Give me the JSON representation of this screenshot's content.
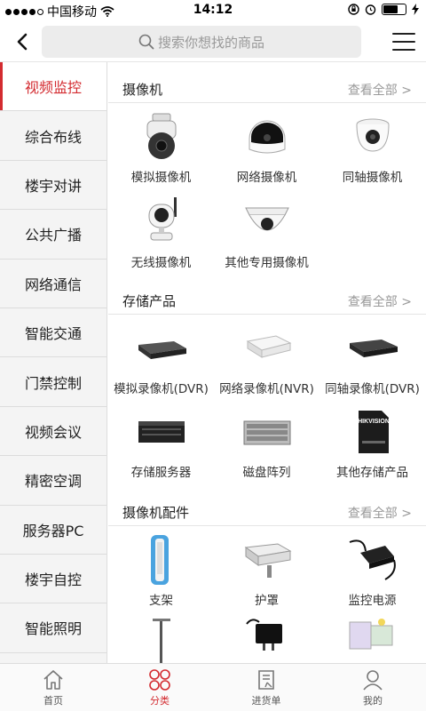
{
  "status": {
    "carrier": "中国移动",
    "time": "14:12",
    "battery_level": 0.7
  },
  "header": {
    "search_placeholder": "搜索你想找的商品"
  },
  "sidebar": {
    "items": [
      {
        "label": "视频监控"
      },
      {
        "label": "综合布线"
      },
      {
        "label": "楼宇对讲"
      },
      {
        "label": "公共广播"
      },
      {
        "label": "网络通信"
      },
      {
        "label": "智能交通"
      },
      {
        "label": "门禁控制"
      },
      {
        "label": "视频会议"
      },
      {
        "label": "精密空调"
      },
      {
        "label": "服务器PC"
      },
      {
        "label": "楼宇自控"
      },
      {
        "label": "智能照明"
      }
    ]
  },
  "sections": [
    {
      "title": "摄像机",
      "more": "查看全部 >",
      "products": [
        {
          "name": "模拟摄像机",
          "icon": "ptz-dome-camera-icon"
        },
        {
          "name": "网络摄像机",
          "icon": "network-camera-icon"
        },
        {
          "name": "同轴摄像机",
          "icon": "coax-dome-camera-icon"
        },
        {
          "name": "无线摄像机",
          "icon": "wireless-camera-icon"
        },
        {
          "name": "其他专用摄像机",
          "icon": "special-camera-icon"
        }
      ]
    },
    {
      "title": "存储产品",
      "more": "查看全部 >",
      "products": [
        {
          "name": "模拟录像机(DVR)",
          "icon": "dvr-icon"
        },
        {
          "name": "网络录像机(NVR)",
          "icon": "nvr-icon"
        },
        {
          "name": "同轴录像机(DVR)",
          "icon": "coax-dvr-icon"
        },
        {
          "name": "存储服务器",
          "icon": "storage-server-icon"
        },
        {
          "name": "磁盘阵列",
          "icon": "disk-array-icon"
        },
        {
          "name": "其他存储产品",
          "icon": "sd-card-icon"
        }
      ]
    },
    {
      "title": "摄像机配件",
      "more": "查看全部 >",
      "products": [
        {
          "name": "支架",
          "icon": "bracket-icon"
        },
        {
          "name": "护罩",
          "icon": "housing-icon"
        },
        {
          "name": "监控电源",
          "icon": "power-adapter-icon"
        }
      ]
    }
  ],
  "sd_card_label": "HIKVISION",
  "tabs": [
    {
      "label": "首页",
      "icon": "home-icon"
    },
    {
      "label": "分类",
      "icon": "category-icon"
    },
    {
      "label": "进货单",
      "icon": "order-icon"
    },
    {
      "label": "我的",
      "icon": "user-icon"
    }
  ],
  "colors": {
    "accent": "#d32b30",
    "sidebar_bg": "#f4f4f4",
    "search_bg": "#ececec"
  }
}
